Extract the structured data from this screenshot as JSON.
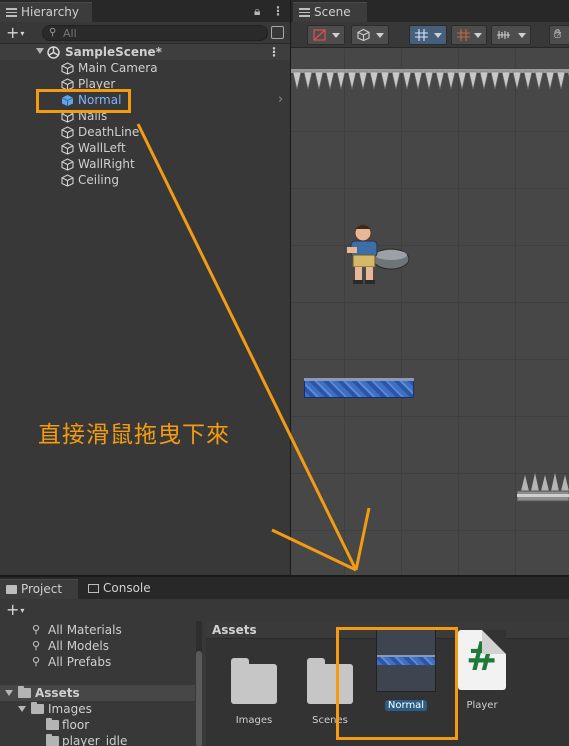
{
  "hierarchy": {
    "tab_label": "Hierarchy",
    "search_placeholder": "All",
    "scene_name": "SampleScene*",
    "items": [
      {
        "label": "Main Camera"
      },
      {
        "label": "Player"
      },
      {
        "label": "Normal"
      },
      {
        "label": "Nails"
      },
      {
        "label": "DeathLine"
      },
      {
        "label": "WallLeft"
      },
      {
        "label": "WallRight"
      },
      {
        "label": "Ceiling"
      }
    ],
    "selected_item": "Normal"
  },
  "scene": {
    "tab_label": "Scene"
  },
  "bottom": {
    "tabs": [
      {
        "label": "Project"
      },
      {
        "label": "Console"
      }
    ],
    "favorites": [
      {
        "label": "All Materials"
      },
      {
        "label": "All Models"
      },
      {
        "label": "All Prefabs"
      }
    ],
    "tree": {
      "root": "Assets",
      "children": [
        {
          "label": "Images"
        },
        {
          "label": "floor"
        },
        {
          "label": "player_idle"
        }
      ]
    },
    "assets_header": "Assets",
    "assets": [
      {
        "label": "Images",
        "type": "folder"
      },
      {
        "label": "Scenes",
        "type": "folder"
      },
      {
        "label": "Normal",
        "type": "prefab",
        "selected": true
      },
      {
        "label": "Player",
        "type": "script"
      }
    ]
  },
  "annotation": {
    "text": "直接滑鼠拖曳下來",
    "color": "#f39c12"
  },
  "colors": {
    "selection_blue": "#2c5d87",
    "highlight_text": "#7fb4ff",
    "annotation_orange": "#f39c12"
  }
}
